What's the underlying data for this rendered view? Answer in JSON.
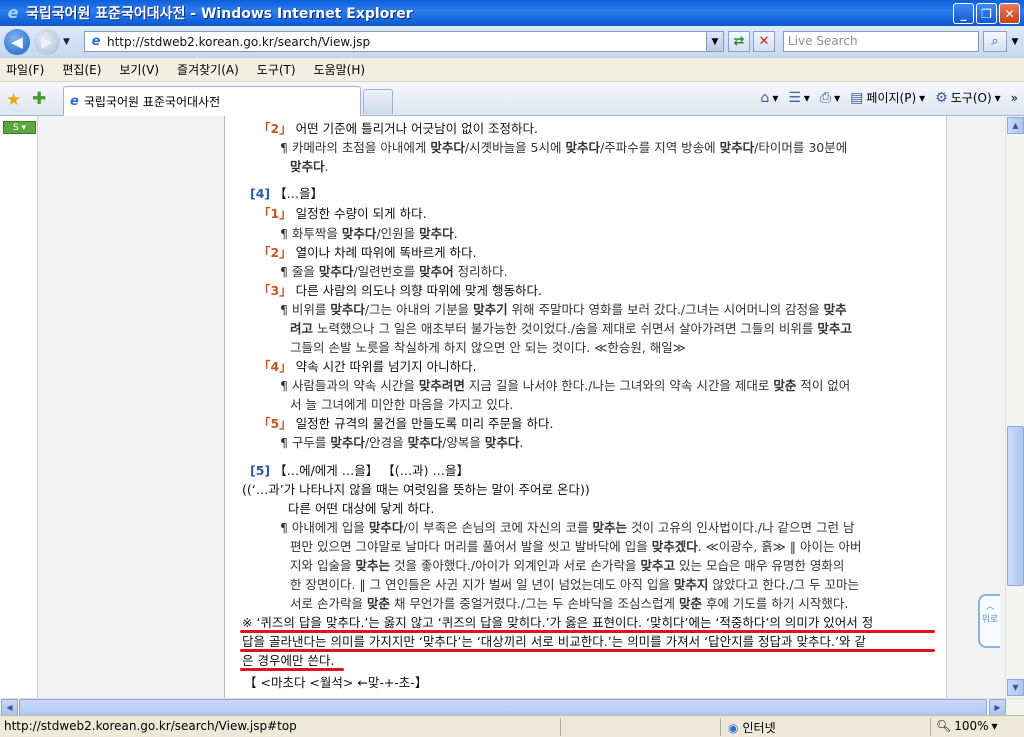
{
  "window": {
    "title": "국립국어원 표준국어대사전 - Windows Internet Explorer",
    "minimize": "_",
    "maximize": "❐",
    "close": "✕"
  },
  "address": {
    "url": "http://stdweb2.korean.go.kr/search/View.jsp",
    "search_placeholder": "Live Search"
  },
  "menu": [
    "파일(F)",
    "편집(E)",
    "보기(V)",
    "즐겨찾기(A)",
    "도구(T)",
    "도움말(H)"
  ],
  "tab": {
    "label": "국립국어원 표준국어대사전"
  },
  "commands": {
    "page": "페이지(P)",
    "tools": "도구(O)"
  },
  "entry": {
    "lines": [
      {
        "type": "sense",
        "num": "「2」",
        "text": "어떤 기준에 틀리거나 어긋남이 없이 조정하다."
      },
      {
        "type": "ex",
        "html": "¶ 카메라의 초점을 아내에게 <b>맞추다</b>/시곗바늘을 5시에 <b>맞추다</b>/주파수를 지역 방송에 <b>맞추다</b>/타이머를 30분에"
      },
      {
        "type": "ex2",
        "html": "<b>맞추다</b>."
      },
      {
        "type": "group",
        "num": "[4]",
        "text": "【…을】"
      },
      {
        "type": "sense",
        "num": "「1」",
        "text": "일정한 수량이 되게 하다."
      },
      {
        "type": "ex",
        "html": "¶ 화투짝을 <b>맞추다</b>/인원을 <b>맞추다</b>."
      },
      {
        "type": "sense",
        "num": "「2」",
        "text": "열이나 차례 따위에 똑바르게 하다."
      },
      {
        "type": "ex",
        "html": "¶ 줄을 <b>맞추다</b>/일련번호를 <b>맞추어</b> 정리하다."
      },
      {
        "type": "sense",
        "num": "「3」",
        "text": "다른 사람의 의도나 의향 따위에 맞게 행동하다."
      },
      {
        "type": "ex",
        "html": "¶ 비위를 <b>맞추다</b>/그는 아내의 기분을 <b>맞추기</b> 위해 주말마다 영화를 보러 갔다./그녀는 시어머니의 감정을 <b>맞추</b>"
      },
      {
        "type": "ex2",
        "html": "<b>려고</b> 노력했으나 그 일은 애초부터 불가능한 것이었다./숨을 제대로 쉬면서 살아가려면 그들의 비위를 <b>맞추고</b>"
      },
      {
        "type": "ex2",
        "html": "그들의 손발 노릇을 착실하게 하지 않으면 안 되는 것이다. ≪한승원, 해일≫"
      },
      {
        "type": "sense",
        "num": "「4」",
        "text": "약속 시간 따위를 넘기지 아니하다."
      },
      {
        "type": "ex",
        "html": "¶ 사람들과의 약속 시간을 <b>맞추려면</b> 지금 길을 나서야 한다./나는 그녀와의 약속 시간을 제대로 <b>맞춘</b> 적이 없어"
      },
      {
        "type": "ex2",
        "html": "서 늘 그녀에게 미안한 마음을 가지고 있다."
      },
      {
        "type": "sense",
        "num": "「5」",
        "text": "일정한 규격의 물건을 만들도록 미리 주문을 하다."
      },
      {
        "type": "ex",
        "html": "¶ 구두를 <b>맞추다</b>/안경을 <b>맞추다</b>/양복을 <b>맞추다</b>."
      },
      {
        "type": "group",
        "num": "[5]",
        "text": "【…에/에게 …을】 【(…과) …을】"
      },
      {
        "type": "plain",
        "text": "((‘…과’가 나타나지 않을 때는 여럿임을 뜻하는 말이 주어로 온다))"
      },
      {
        "type": "def",
        "text": "다른 어떤 대상에 닿게 하다."
      },
      {
        "type": "ex",
        "html": "¶ 아내에게 입을 <b>맞추다</b>/이 부족은 손님의 코에 자신의 코를 <b>맞추는</b> 것이 고유의 인사법이다./나 같으면 그런 남"
      },
      {
        "type": "ex2",
        "html": "편만 있으면 그야말로 날마다 머리를 풀어서 발을 씻고 발바닥에 입을 <b>맞추겠다</b>. ≪이광수, 흙≫ ‖ 아이는 아버"
      },
      {
        "type": "ex2",
        "html": "지와 입술을 <b>맞추는</b> 것을 좋아했다./아이가 외계인과 서로 손가락을 <b>맞추고</b> 있는 모습은 매우 유명한 영화의"
      },
      {
        "type": "ex2",
        "html": "한 장면이다. ‖ 그 연인들은 사귄 지가 벌써 일 년이 넘었는데도 아직 입을 <b>맞추지</b> 않았다고 한다./그 두 꼬마는"
      },
      {
        "type": "ex2",
        "html": "서로 손가락을 <b>맞춘</b> 채 무언가를 중얼거렸다./그는 두 손바닥을 조심스럽게 <b>맞춘</b> 후에 기도를 하기 시작했다."
      }
    ],
    "note": [
      "※ ‘퀴즈의 답을 맞추다.’는 옳지 않고 ‘퀴즈의 답을 맞히다.’가 옳은 표현이다. ‘맞히다’에는 ‘적중하다’의 의미가 있어서 정",
      "답을 골라낸다는 의미를 가지지만 ‘맞추다’는 ‘대상끼리 서로 비교한다.’는 의미를 가져서 ‘답안지를 정답과 맞추다.’와 같",
      "은 경우에만 쓴다."
    ],
    "footer": "【 <마초다 <월석> ←맞-+-초-】"
  },
  "side_tab": "위로",
  "status": {
    "url": "http://stdweb2.korean.go.kr/search/View.jsp#top",
    "zone": "인터넷",
    "zoom": "100%"
  },
  "colors": {
    "titlebar": "#0b58d0",
    "sense_number": "#c2562a",
    "group_number": "#2a5aa8",
    "highlight_underline": "#e0141e"
  }
}
